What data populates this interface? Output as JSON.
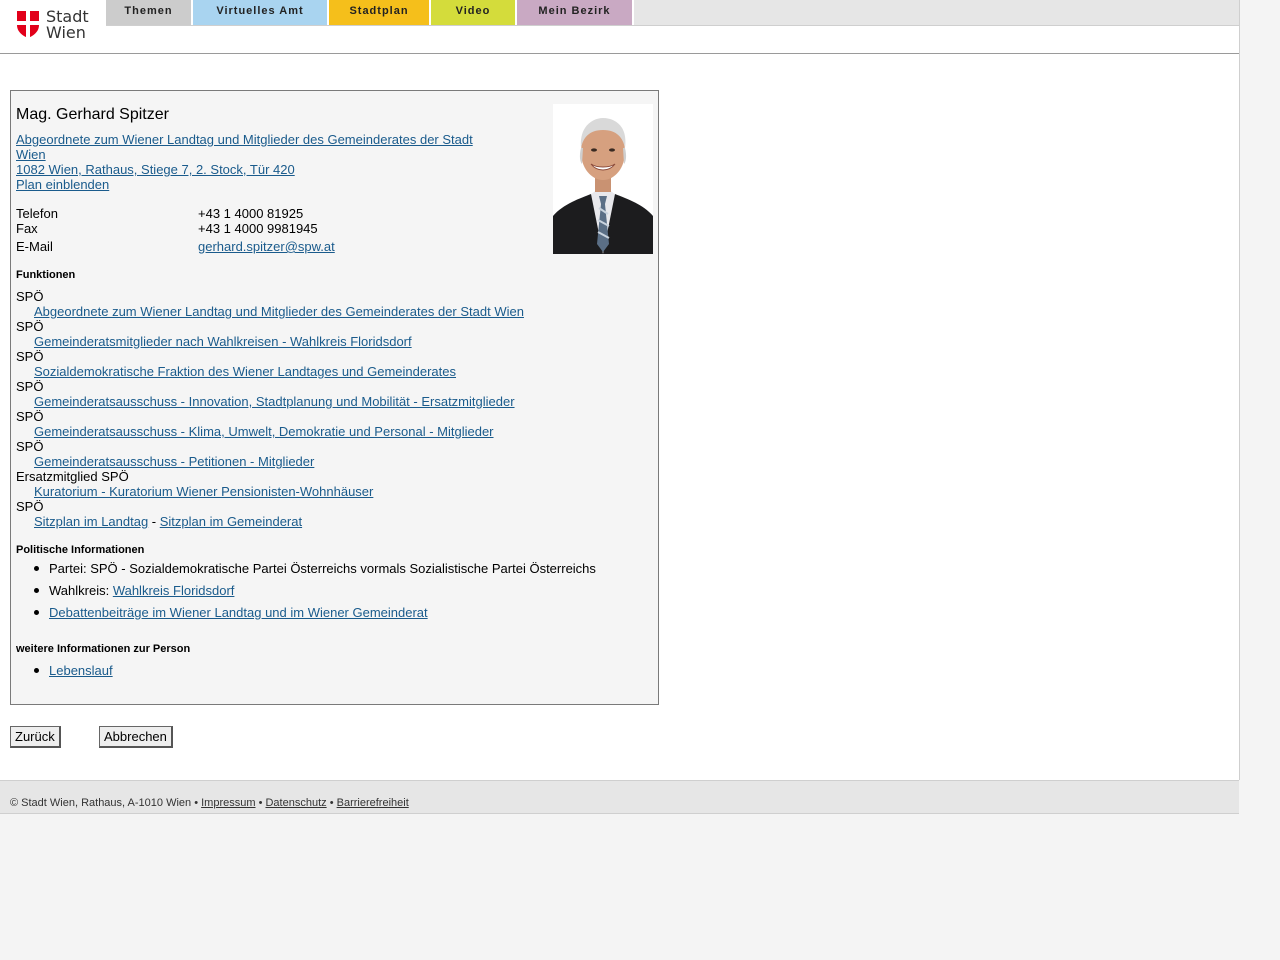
{
  "header": {
    "logo_line1": "Stadt",
    "logo_line2": "Wien",
    "nav": [
      {
        "label": "Themen",
        "color": "#cccccc"
      },
      {
        "label": "Virtuelles Amt",
        "color": "#a9d4f0"
      },
      {
        "label": "Stadtplan",
        "color": "#f5bf1b"
      },
      {
        "label": "Video",
        "color": "#d4dc3b"
      },
      {
        "label": "Mein Bezirk",
        "color": "#c9a9c3"
      }
    ]
  },
  "person": {
    "name": "Mag. Gerhard Spitzer",
    "role_link_line1": "Abgeordnete zum Wiener Landtag und Mitglieder des Gemeinderates der Stadt",
    "role_link_line2": "Wien",
    "address_link": "1082 Wien, Rathaus, Stiege 7, 2. Stock, Tür 420",
    "plan_link": "Plan einblenden",
    "contact": {
      "phone_label": "Telefon",
      "phone": "+43 1 4000 81925",
      "fax_label": "Fax",
      "fax": "+43 1 4000 9981945",
      "email_label": "E-Mail",
      "email": "gerhard.spitzer@spw.at"
    }
  },
  "funktionen": {
    "heading": "Funktionen",
    "items": [
      {
        "party": "SPÖ",
        "link": "Abgeordnete zum Wiener Landtag und Mitglieder des Gemeinderates der Stadt Wien"
      },
      {
        "party": "SPÖ",
        "link": "Gemeinderatsmitglieder nach Wahlkreisen - Wahlkreis Floridsdorf"
      },
      {
        "party": "SPÖ",
        "link": "Sozialdemokratische Fraktion des Wiener Landtages und Gemeinderates"
      },
      {
        "party": "SPÖ",
        "link": "Gemeinderatsausschuss - Innovation, Stadtplanung und Mobilität - Ersatzmitglieder"
      },
      {
        "party": "SPÖ",
        "link": "Gemeinderatsausschuss - Klima, Umwelt, Demokratie und Personal - Mitglieder"
      },
      {
        "party": "SPÖ",
        "link": "Gemeinderatsausschuss - Petitionen - Mitglieder"
      },
      {
        "party": "Ersatzmitglied SPÖ",
        "link": "Kuratorium - Kuratorium Wiener Pensionisten-Wohnhäuser"
      }
    ],
    "seating_party": "SPÖ",
    "seating_landtag": "Sitzplan im Landtag",
    "seating_sep": " - ",
    "seating_gemeinderat": "Sitzplan im Gemeinderat"
  },
  "politik": {
    "heading": "Politische Informationen",
    "partei_label": "Partei: ",
    "partei_value": "SPÖ - Sozialdemokratische Partei Österreichs vormals Sozialistische Partei Österreichs",
    "wahlkreis_label": "Wahlkreis: ",
    "wahlkreis_link": "Wahlkreis Floridsdorf",
    "debatten_link": "Debattenbeiträge im Wiener Landtag und im Wiener Gemeinderat"
  },
  "weitere": {
    "heading": "weitere Informationen zur Person",
    "lebenslauf_link": "Lebenslauf"
  },
  "buttons": {
    "back": "Zurück",
    "cancel": "Abbrechen"
  },
  "footer": {
    "copyright": "© Stadt Wien, Rathaus, A-1010 Wien • ",
    "impressum": "Impressum",
    "sep": " • ",
    "datenschutz": "Datenschutz",
    "barrierefreiheit": "Barrierefreiheit"
  }
}
